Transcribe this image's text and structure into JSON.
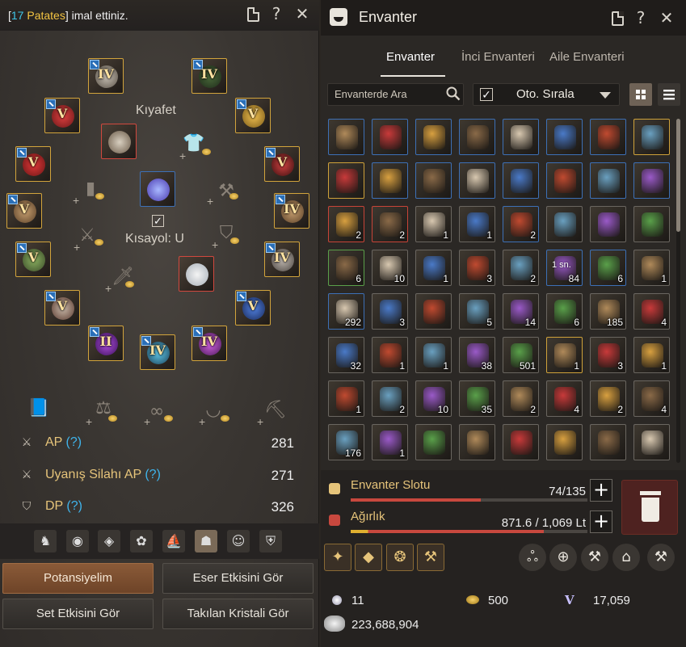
{
  "notification": {
    "prefix": "[",
    "qty": "17",
    "item": "Patates",
    "suffix": "] imal ettiniz."
  },
  "equipment": {
    "outfit_label": "Kıyafet",
    "shortcut_label": "Kısayol: U",
    "ranks": [
      "IV",
      "IV",
      "V",
      "V",
      "V",
      "V",
      "V",
      "IV",
      "V",
      "IV",
      "II",
      "IV",
      "IV",
      "V",
      "V"
    ]
  },
  "stats": [
    {
      "name": "AP",
      "q": "(?)",
      "value": "281"
    },
    {
      "name": "Uyanış Silahı AP",
      "q": "(?)",
      "value": "271"
    },
    {
      "name": "DP",
      "q": "(?)",
      "value": "326"
    }
  ],
  "left_buttons": {
    "potential": "Potansiyelim",
    "artifact": "Eser Etkisini Gör",
    "set": "Set Etkisini Gör",
    "crystal": "Takılan Kristali Gör"
  },
  "inventory": {
    "title": "Envanter",
    "tabs": [
      "Envanter",
      "İnci Envanteri",
      "Aile Envanteri"
    ],
    "search_placeholder": "Envanterde Ara",
    "sort_label": "Oto. Sırala",
    "rows": [
      [
        {
          "b": "blue"
        },
        {
          "b": "blue"
        },
        {
          "b": "blue"
        },
        {
          "b": "blue"
        },
        {
          "b": "blue"
        },
        {
          "b": "blue"
        },
        {
          "b": "blue"
        },
        {
          "b": "gold"
        }
      ],
      [
        {
          "b": "gold"
        },
        {
          "b": "blue"
        },
        {
          "b": "blue"
        },
        {
          "b": "blue"
        },
        {
          "b": "blue"
        },
        {
          "b": "blue"
        },
        {
          "b": "blue"
        },
        {
          "b": "blue"
        }
      ],
      [
        {
          "b": "red",
          "c": "2"
        },
        {
          "b": "red",
          "c": "2"
        },
        {
          "b": "gray",
          "c": "1"
        },
        {
          "b": "gray",
          "c": "1"
        },
        {
          "b": "blue",
          "c": "2"
        },
        {
          "b": "gray"
        },
        {
          "b": "gray"
        },
        {
          "b": "gray"
        }
      ],
      [
        {
          "b": "green",
          "c": "6"
        },
        {
          "b": "gray",
          "c": "10"
        },
        {
          "b": "gray",
          "c": "1"
        },
        {
          "b": "gray",
          "c": "3"
        },
        {
          "b": "gray",
          "c": "2"
        },
        {
          "b": "blue",
          "c": "84",
          "sn": "1 sn."
        },
        {
          "b": "blue",
          "c": "6"
        },
        {
          "b": "gray",
          "c": "1"
        }
      ],
      [
        {
          "b": "blue",
          "c": "292"
        },
        {
          "b": "gray",
          "c": "3"
        },
        {
          "b": "gray"
        },
        {
          "b": "gray",
          "c": "5"
        },
        {
          "b": "gray",
          "c": "14"
        },
        {
          "b": "gray",
          "c": "6"
        },
        {
          "b": "gray",
          "c": "185"
        },
        {
          "b": "gray",
          "c": "4"
        }
      ],
      [
        {
          "b": "gray",
          "c": "32"
        },
        {
          "b": "gray",
          "c": "1"
        },
        {
          "b": "gray",
          "c": "1"
        },
        {
          "b": "gray",
          "c": "38"
        },
        {
          "b": "gray",
          "c": "501"
        },
        {
          "b": "gold",
          "c": "1"
        },
        {
          "b": "gray",
          "c": "3"
        },
        {
          "b": "gray",
          "c": "1"
        }
      ],
      [
        {
          "b": "gray",
          "c": "1"
        },
        {
          "b": "gray",
          "c": "2"
        },
        {
          "b": "gray",
          "c": "10"
        },
        {
          "b": "gray",
          "c": "35"
        },
        {
          "b": "gray",
          "c": "2"
        },
        {
          "b": "gray",
          "c": "4"
        },
        {
          "b": "gray",
          "c": "2"
        },
        {
          "b": "gray",
          "c": "4"
        }
      ],
      [
        {
          "b": "gray",
          "c": "176"
        },
        {
          "b": "gray",
          "c": "1"
        },
        {
          "b": "gray"
        },
        {
          "b": "gray"
        },
        {
          "b": "gray"
        },
        {
          "b": "gray"
        },
        {
          "b": "gray"
        },
        {
          "b": "gray"
        }
      ]
    ],
    "slot_label": "Envanter Slotu",
    "slot_value": "74/135",
    "slot_fill": 0.548,
    "weight_label": "Ağırlık",
    "weight_value": "871.6 / 1,069 Lt",
    "weight_fill": 0.815,
    "pearls": "11",
    "tokens": "500",
    "value_pack": "17,059",
    "silver": "223,688,904",
    "colors": {
      "accent_gold": "#e6c47a",
      "help_blue": "#3fb4ec",
      "bar_red": "#c8483e",
      "bar_gold": "#e0b030"
    }
  }
}
